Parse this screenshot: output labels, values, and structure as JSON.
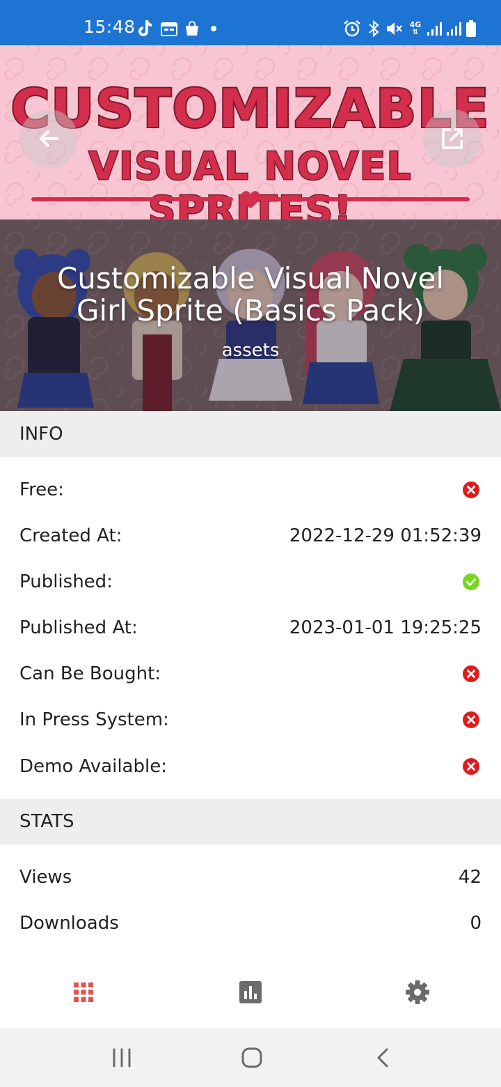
{
  "status_bar": {
    "time": "15:48",
    "left_icons": [
      "tiktok-icon",
      "calendar-icon",
      "shopping-bag-icon",
      "dot-icon"
    ],
    "right_icons": [
      "alarm-icon",
      "bluetooth-icon",
      "mute-icon",
      "4g-icon",
      "signal-icon",
      "signal-icon",
      "battery-icon"
    ],
    "network_label": "4G"
  },
  "hero": {
    "banner_line1": "CUSTOMIZABLE",
    "banner_line2": "VISUAL NOVEL SPRITES!",
    "title": "Customizable Visual Novel Girl Sprite (Basics Pack)",
    "subtitle": "assets",
    "back_icon": "arrow-back-icon",
    "open_icon": "open-external-icon"
  },
  "info": {
    "header": "INFO",
    "rows": [
      {
        "label": "Free:",
        "status": "no"
      },
      {
        "label": "Created At:",
        "value": "2022-12-29 01:52:39"
      },
      {
        "label": "Published:",
        "status": "yes"
      },
      {
        "label": "Published At:",
        "value": "2023-01-01 19:25:25"
      },
      {
        "label": "Can Be Bought:",
        "status": "no"
      },
      {
        "label": "In Press System:",
        "status": "no"
      },
      {
        "label": "Demo Available:",
        "status": "no"
      }
    ]
  },
  "stats": {
    "header": "STATS",
    "rows": [
      {
        "label": "Views",
        "value": "42"
      },
      {
        "label": "Downloads",
        "value": "0"
      }
    ]
  },
  "bottom_nav": {
    "items": [
      "grid-icon",
      "bar-chart-icon",
      "settings-icon"
    ],
    "active_color": "#e5534b",
    "inactive_color": "#6b6b6b"
  },
  "colors": {
    "status_bar": "#1e74d2",
    "no_icon": "#e01b1b",
    "yes_icon": "#76d61e",
    "section_bg": "#eeeeee"
  }
}
